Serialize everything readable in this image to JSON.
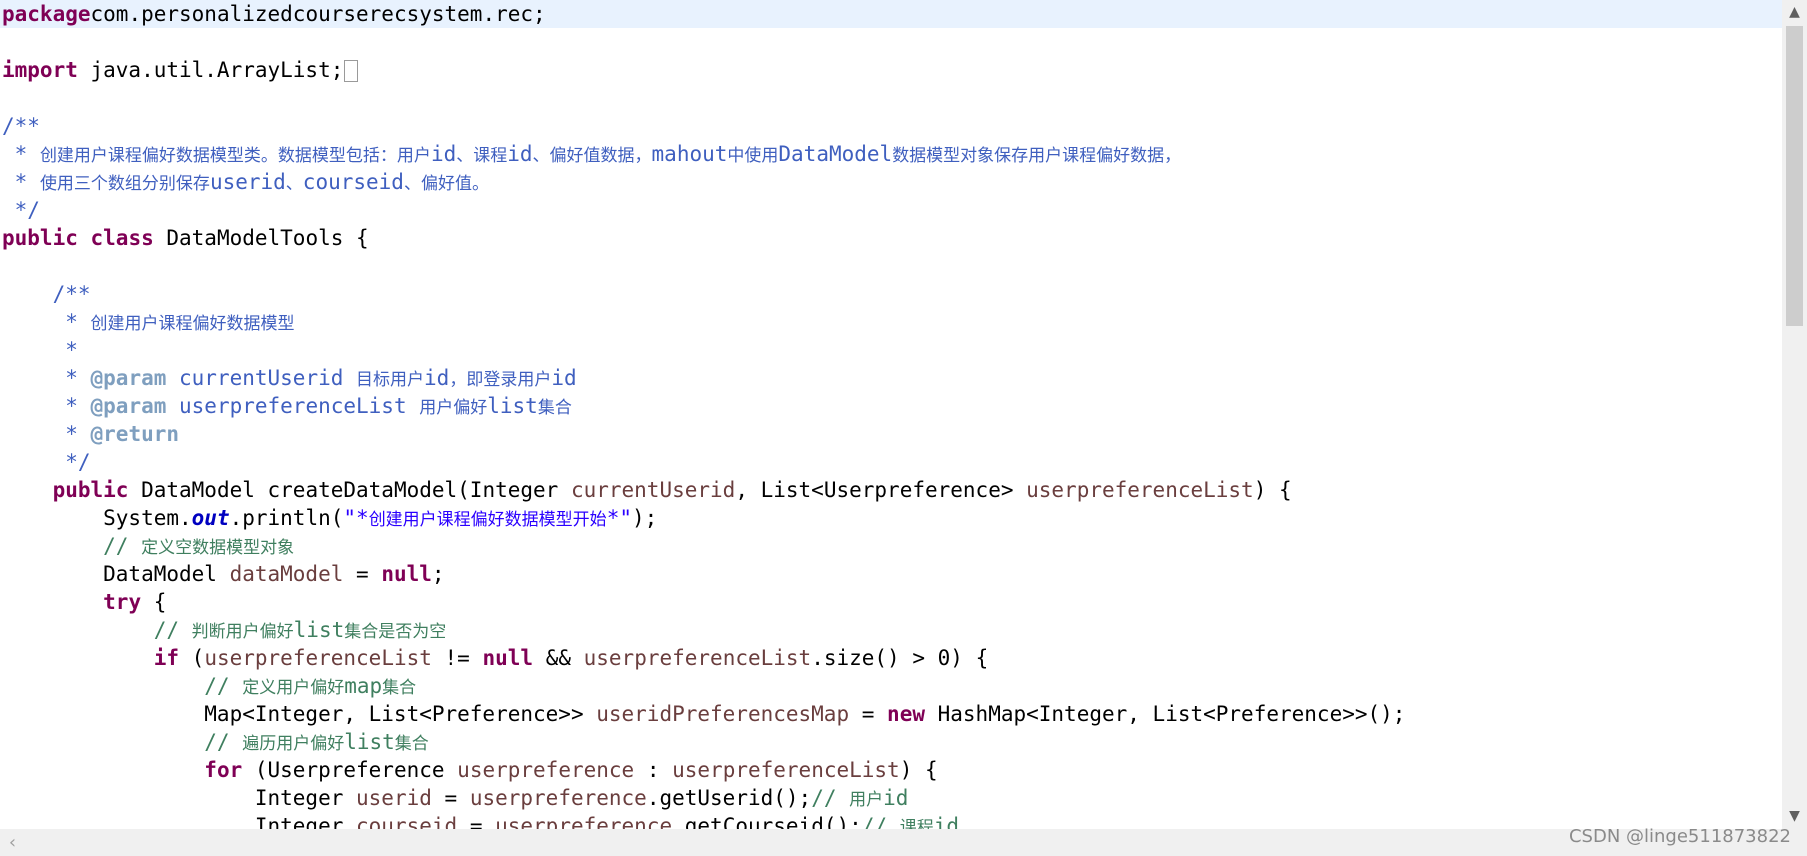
{
  "editor": {
    "language": "java",
    "colors": {
      "keyword": "#7f0055",
      "comment": "#3f7f5f",
      "javadoc": "#3f5fbf",
      "javadoc_tag": "#7f9fbf",
      "string": "#2a00ff",
      "local_variable": "#6a3e3e",
      "static_field": "#0000c0",
      "current_line": "#e8f2fe"
    },
    "lines": [
      {
        "t": [
          [
            "kw",
            "package"
          ],
          [
            "",
            "com.personalizedcourserecsystem.rec;"
          ]
        ]
      },
      {
        "t": []
      },
      {
        "t": [
          [
            "kw",
            "import"
          ],
          [
            "",
            " java.util.ArrayList;"
          ]
        ],
        "fold": true
      },
      {
        "t": []
      },
      {
        "t": [
          [
            "jd",
            "/**"
          ]
        ]
      },
      {
        "t": [
          [
            "jd",
            " * "
          ],
          [
            "jd cj",
            "创建用户课程偏好数据模型类。数据模型包括：用户"
          ],
          [
            "jd",
            "id"
          ],
          [
            "jd cj",
            "、课程"
          ],
          [
            "jd",
            "id"
          ],
          [
            "jd cj",
            "、偏好值数据，"
          ],
          [
            "jd",
            "mahout"
          ],
          [
            "jd cj",
            "中使用"
          ],
          [
            "jd",
            "DataModel"
          ],
          [
            "jd cj",
            "数据模型对象保存用户课程偏好数据，"
          ]
        ]
      },
      {
        "t": [
          [
            "jd",
            " * "
          ],
          [
            "jd cj",
            "使用三个数组分别保存"
          ],
          [
            "jd",
            "userid"
          ],
          [
            "jd cj",
            "、"
          ],
          [
            "jd",
            "courseid"
          ],
          [
            "jd cj",
            "、偏好值。"
          ]
        ]
      },
      {
        "t": [
          [
            "jd",
            " */"
          ]
        ]
      },
      {
        "t": [
          [
            "kw",
            "public"
          ],
          [
            "",
            " "
          ],
          [
            "kw",
            "class"
          ],
          [
            "",
            " DataModelTools {"
          ]
        ]
      },
      {
        "t": []
      },
      {
        "t": [
          [
            "jd",
            "    /**"
          ]
        ]
      },
      {
        "t": [
          [
            "jd",
            "     * "
          ],
          [
            "jd cj",
            "创建用户课程偏好数据模型"
          ]
        ]
      },
      {
        "t": [
          [
            "jd",
            "     *"
          ]
        ]
      },
      {
        "t": [
          [
            "jd",
            "     * "
          ],
          [
            "tag",
            "@param"
          ],
          [
            "jd",
            " currentUserid "
          ],
          [
            "jd cj",
            "目标用户"
          ],
          [
            "jd",
            "id"
          ],
          [
            "jd cj",
            "，即登录用户"
          ],
          [
            "jd",
            "id"
          ]
        ]
      },
      {
        "t": [
          [
            "jd",
            "     * "
          ],
          [
            "tag",
            "@param"
          ],
          [
            "jd",
            " userpreferenceList "
          ],
          [
            "jd cj",
            "用户偏好"
          ],
          [
            "jd",
            "list"
          ],
          [
            "jd cj",
            "集合"
          ]
        ]
      },
      {
        "t": [
          [
            "jd",
            "     * "
          ],
          [
            "tag",
            "@return"
          ]
        ]
      },
      {
        "t": [
          [
            "jd",
            "     */"
          ]
        ]
      },
      {
        "t": [
          [
            "",
            "    "
          ],
          [
            "kw",
            "public"
          ],
          [
            "",
            " DataModel createDataModel(Integer "
          ],
          [
            "var",
            "currentUserid"
          ],
          [
            "",
            ", List<Userpreference> "
          ],
          [
            "var",
            "userpreferenceList"
          ],
          [
            "",
            ") {"
          ]
        ]
      },
      {
        "t": [
          [
            "",
            "        System."
          ],
          [
            "st",
            "out"
          ],
          [
            "",
            ".println("
          ],
          [
            "str",
            "\"*"
          ],
          [
            "str cj",
            "创建用户课程偏好数据模型开始"
          ],
          [
            "str",
            "*\""
          ],
          [
            "",
            ");"
          ]
        ]
      },
      {
        "t": [
          [
            "cm",
            "        // "
          ],
          [
            "cm cj",
            "定义空数据模型对象"
          ]
        ]
      },
      {
        "t": [
          [
            "",
            "        DataModel "
          ],
          [
            "var",
            "dataModel"
          ],
          [
            "",
            " = "
          ],
          [
            "kw",
            "null"
          ],
          [
            "",
            ";"
          ]
        ]
      },
      {
        "t": [
          [
            "",
            "        "
          ],
          [
            "kw",
            "try"
          ],
          [
            "",
            " {"
          ]
        ]
      },
      {
        "t": [
          [
            "cm",
            "            // "
          ],
          [
            "cm cj",
            "判断用户偏好"
          ],
          [
            "cm",
            "list"
          ],
          [
            "cm cj",
            "集合是否为空"
          ]
        ]
      },
      {
        "t": [
          [
            "",
            "            "
          ],
          [
            "kw",
            "if"
          ],
          [
            "",
            " ("
          ],
          [
            "var",
            "userpreferenceList"
          ],
          [
            "",
            " != "
          ],
          [
            "kw",
            "null"
          ],
          [
            "",
            " && "
          ],
          [
            "var",
            "userpreferenceList"
          ],
          [
            "",
            ".size() > 0) {"
          ]
        ]
      },
      {
        "t": [
          [
            "cm",
            "                // "
          ],
          [
            "cm cj",
            "定义用户偏好"
          ],
          [
            "cm",
            "map"
          ],
          [
            "cm cj",
            "集合"
          ]
        ]
      },
      {
        "t": [
          [
            "",
            "                Map<Integer, List<Preference>> "
          ],
          [
            "var",
            "useridPreferencesMap"
          ],
          [
            "",
            " = "
          ],
          [
            "kw",
            "new"
          ],
          [
            "",
            " HashMap<Integer, List<Preference>>();"
          ]
        ]
      },
      {
        "t": [
          [
            "cm",
            "                // "
          ],
          [
            "cm cj",
            "遍历用户偏好"
          ],
          [
            "cm",
            "list"
          ],
          [
            "cm cj",
            "集合"
          ]
        ]
      },
      {
        "t": [
          [
            "",
            "                "
          ],
          [
            "kw",
            "for"
          ],
          [
            "",
            " (Userpreference "
          ],
          [
            "var",
            "userpreference"
          ],
          [
            "",
            " : "
          ],
          [
            "var",
            "userpreferenceList"
          ],
          [
            "",
            ") {"
          ]
        ]
      },
      {
        "t": [
          [
            "",
            "                    Integer "
          ],
          [
            "var",
            "userid"
          ],
          [
            "",
            " = "
          ],
          [
            "var",
            "userpreference"
          ],
          [
            "",
            ".getUserid();"
          ],
          [
            "cm",
            "// "
          ],
          [
            "cm cj",
            "用户"
          ],
          [
            "cm",
            "id"
          ]
        ]
      },
      {
        "t": [
          [
            "",
            "                    Integer "
          ],
          [
            "var",
            "courseid"
          ],
          [
            "",
            " = "
          ],
          [
            "var",
            "userpreference"
          ],
          [
            "",
            ".getCourseid();"
          ],
          [
            "cm",
            "// "
          ],
          [
            "cm cj",
            "课程"
          ],
          [
            "cm",
            "id"
          ]
        ]
      }
    ]
  },
  "scrollbars": {
    "up_arrow": "▲",
    "down_arrow": "▼",
    "left_arrow": "‹"
  },
  "watermark": "CSDN @linge511873822"
}
